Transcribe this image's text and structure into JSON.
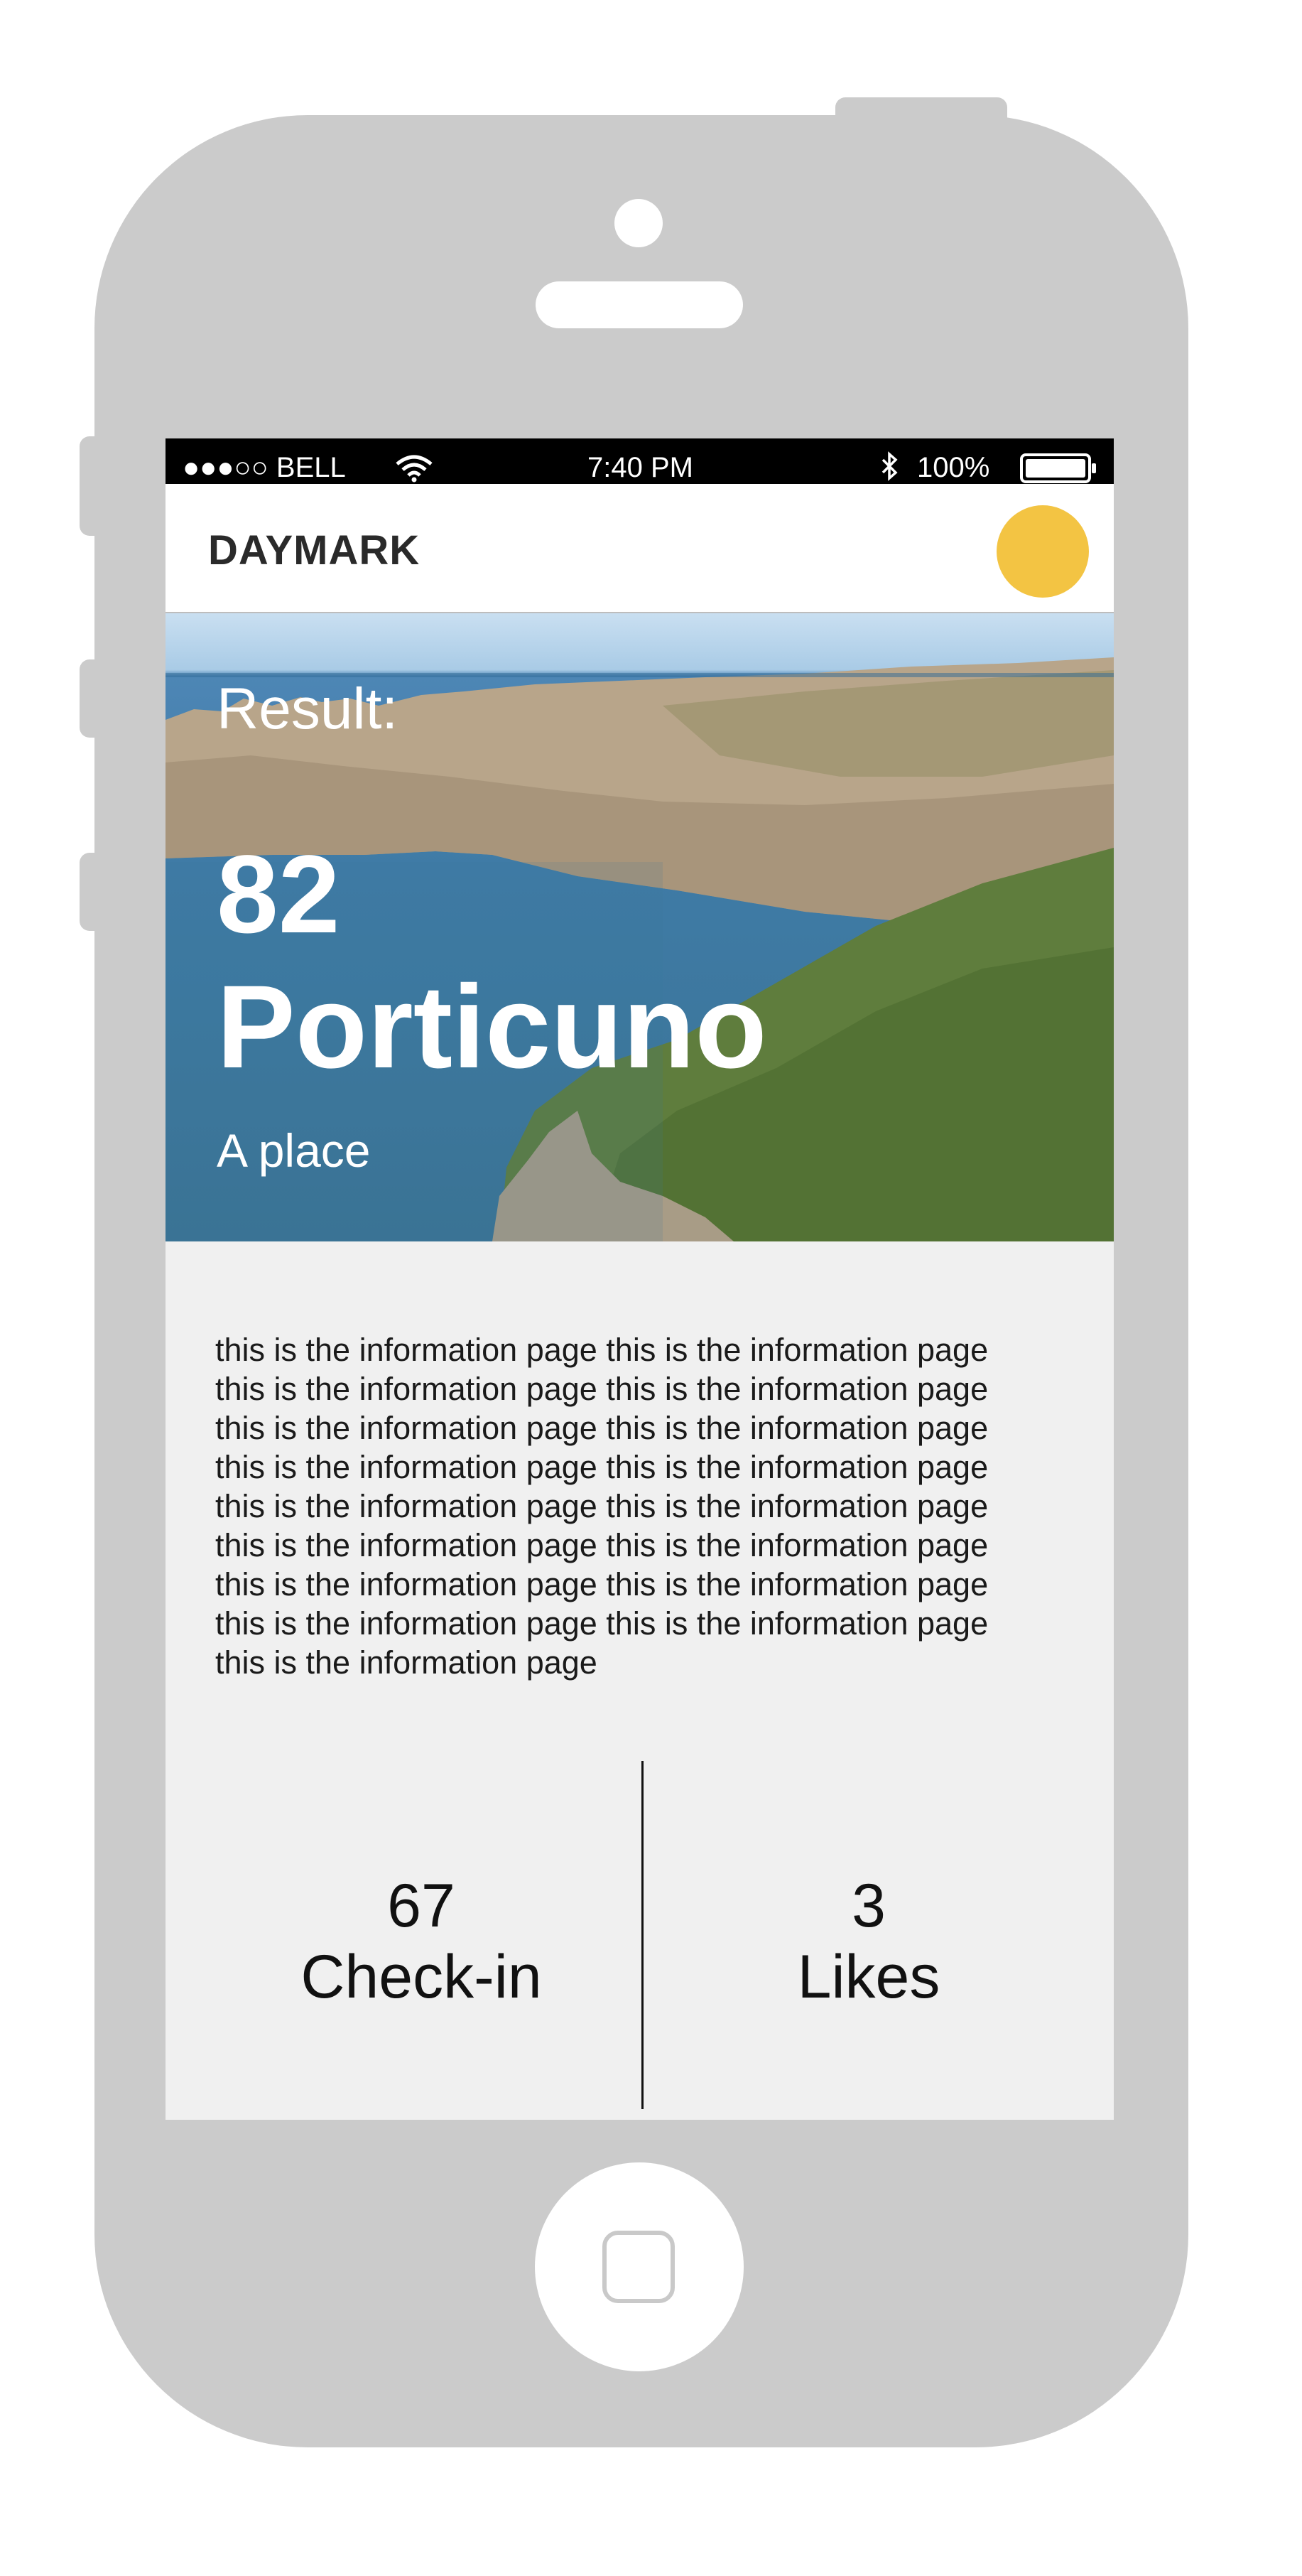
{
  "status_bar": {
    "carrier": "●●●○○ BELL",
    "time": "7:40 PM",
    "battery_percent": "100%",
    "icons": [
      "wifi-icon",
      "bluetooth-icon",
      "battery-icon"
    ]
  },
  "app_bar": {
    "title": "DAYMARK",
    "avatar_color": "#F3C443"
  },
  "hero": {
    "label": "Result:",
    "number": "82",
    "name": "Porticuno",
    "subtitle": "A place"
  },
  "info": {
    "lines": [
      "this is the information page this is the information page",
      "this is the information page this is the information page",
      "this is the information page this is the information page",
      "this is the information page this is the information page",
      "this is the information page this is the information page",
      "this is the information page this is the information page",
      "this is the information page this is the information page",
      "this is the information page this is the information page",
      "this is the information page"
    ]
  },
  "stats": {
    "checkin": {
      "value": "67",
      "label": "Check-in"
    },
    "likes": {
      "value": "3",
      "label": "Likes"
    }
  },
  "colors": {
    "phone_body": "#CBCBCB",
    "screen_bg": "#F0F0F0",
    "accent": "#F3C443"
  }
}
